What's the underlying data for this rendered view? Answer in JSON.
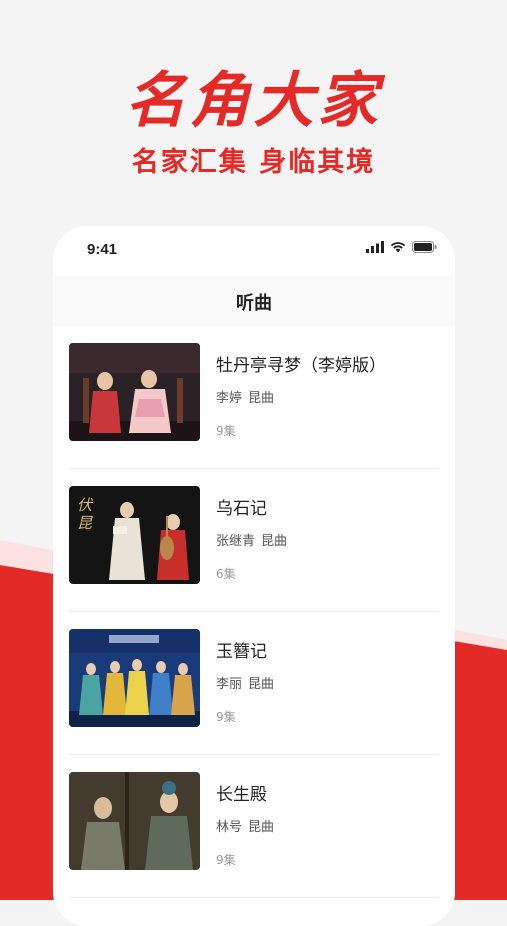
{
  "hero": {
    "title": "名角大家",
    "subtitle": "名家汇集 身临其境"
  },
  "status_bar": {
    "time": "9:41",
    "icons": [
      "signal-icon",
      "wifi-icon",
      "battery-icon"
    ]
  },
  "nav": {
    "title": "听曲"
  },
  "items": [
    {
      "title": "牡丹亭寻梦（李婷版）",
      "artist": "李婷",
      "genre": "昆曲",
      "episodes": "9集",
      "thumbnail": "opera-stage-photo"
    },
    {
      "title": "乌石记",
      "artist": "张继青",
      "genre": "昆曲",
      "episodes": "6集",
      "thumbnail": "opera-stage-photo"
    },
    {
      "title": "玉簪记",
      "artist": "李丽",
      "genre": "昆曲",
      "episodes": "9集",
      "thumbnail": "opera-stage-photo"
    },
    {
      "title": "长生殿",
      "artist": "林号",
      "genre": "昆曲",
      "episodes": "9集",
      "thumbnail": "opera-stage-photo"
    }
  ],
  "colors": {
    "brand_red": "#e32a26",
    "background": "#f4f4f4"
  }
}
